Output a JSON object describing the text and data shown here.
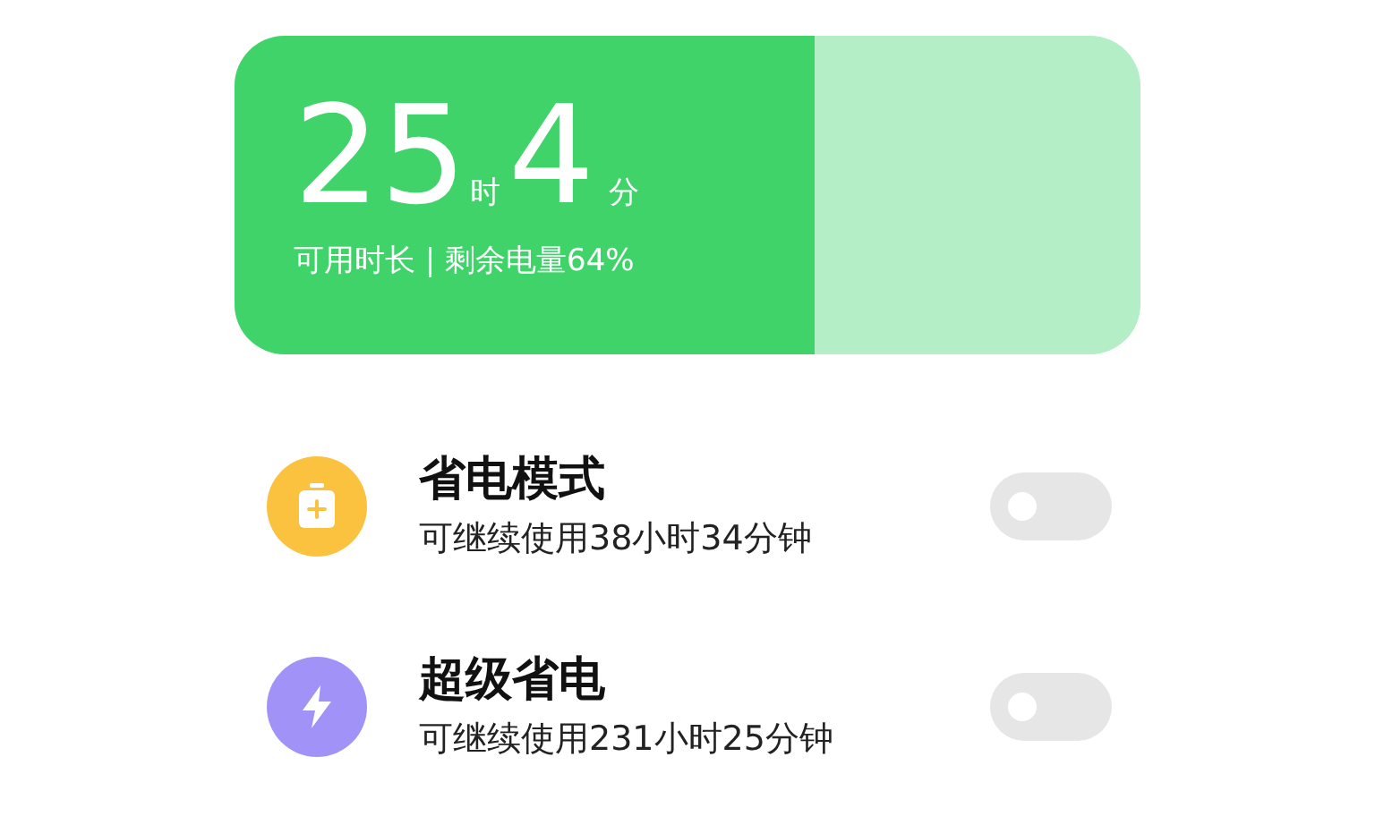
{
  "battery": {
    "level": 0.64,
    "hours": "25",
    "hours_unit": "时",
    "minutes": "4",
    "minutes_unit": "分",
    "caption": "可用时长 | 剩余电量64%"
  },
  "modes": [
    {
      "kind": "battery",
      "color": "#fbc23f",
      "title": "省电模式",
      "subtitle": "可继续使用38小时34分钟",
      "on": false
    },
    {
      "kind": "bolt",
      "color": "#a192f7",
      "title": "超级省电",
      "subtitle": "可继续使用231小时25分钟",
      "on": false
    }
  ]
}
